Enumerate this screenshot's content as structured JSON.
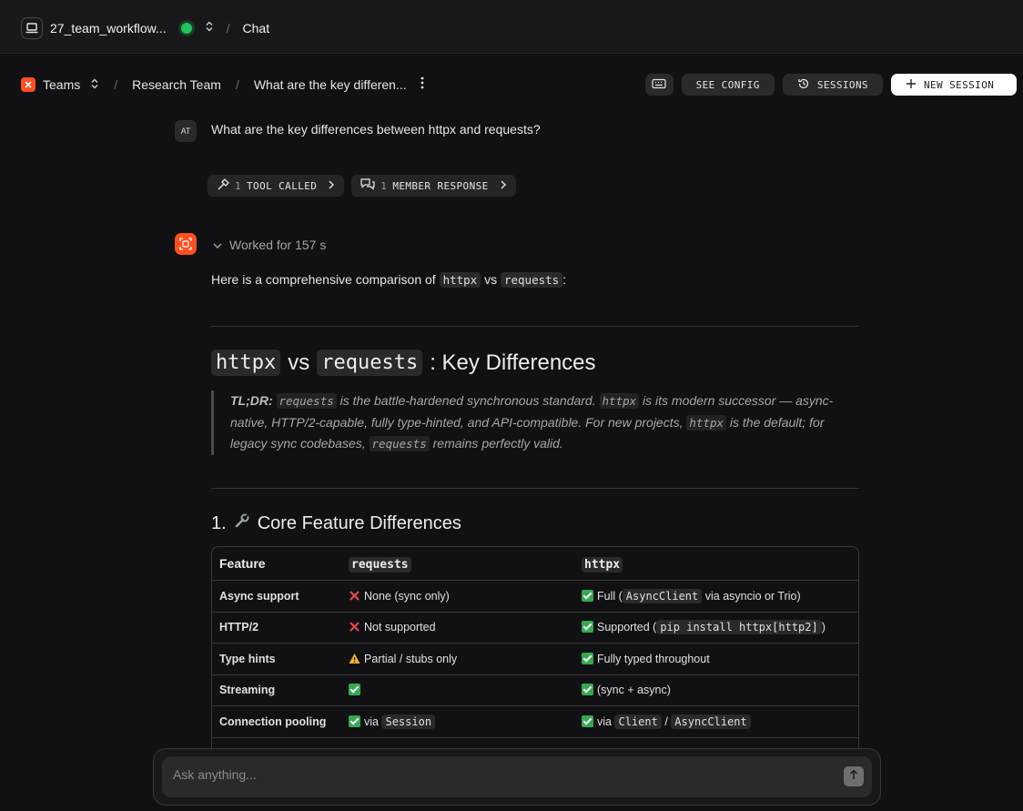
{
  "topbar": {
    "project_name": "27_team_workflow...",
    "status_color": "#22c55e",
    "separator": "/",
    "crumb": "Chat"
  },
  "nav": {
    "teams_label": "Teams",
    "team_name": "Research Team",
    "session_title": "What are the key differen...",
    "see_config": "SEE CONFIG",
    "sessions": "SESSIONS",
    "new_session": "NEW SESSION"
  },
  "message": {
    "avatar": "AT",
    "question": "What are the key differences between httpx and requests?"
  },
  "pills": {
    "tools_count": "1",
    "tools_label": "TOOL CALLED",
    "members_count": "1",
    "members_label": "MEMBER RESPONSE"
  },
  "response": {
    "worked": "Worked for 157 s",
    "intro_pre": "Here is a comprehensive comparison of",
    "intro_code1": "httpx",
    "intro_mid": "vs",
    "intro_code2": "requests",
    "intro_post": ":",
    "h2_code1": "httpx",
    "h2_mid": "vs",
    "h2_code2": "requests",
    "h2_post": ": Key Differences",
    "tldr_label": "TL;DR:",
    "tldr_1": "requests",
    "tldr_2": " is the battle-hardened synchronous standard. ",
    "tldr_3": "httpx",
    "tldr_4": " is its modern successor — async-native, HTTP/2-capable, fully type-hinted, and API-compatible. For new projects, ",
    "tldr_5": "httpx",
    "tldr_6": " is the default; for legacy sync codebases, ",
    "tldr_7": "requests",
    "tldr_8": " remains perfectly valid.",
    "h3_num": "1.",
    "h3_text": "Core Feature Differences"
  },
  "table": {
    "headers": [
      "Feature",
      "requests",
      "httpx"
    ],
    "rows": [
      {
        "feature": "Async support",
        "req": "None (sync only)",
        "httpx_pre": "Full (",
        "httpx_code": "AsyncClient",
        "httpx_post": " via asyncio or Trio)"
      },
      {
        "feature": "HTTP/2",
        "req": "Not supported",
        "httpx_pre": "Supported (",
        "httpx_code": "pip install httpx[http2]",
        "httpx_post": ")"
      },
      {
        "feature": "Type hints",
        "req": "Partial / stubs only",
        "httpx_text": "Fully typed throughout"
      },
      {
        "feature": "Streaming",
        "httpx_text": "(sync + async)"
      },
      {
        "feature": "Connection pooling",
        "req_pre": "via",
        "req_code": "Session",
        "httpx_pre": "via",
        "httpx_code1": "Client",
        "httpx_sep": "/",
        "httpx_code2": "AsyncClient"
      }
    ]
  },
  "composer": {
    "placeholder": "Ask anything..."
  }
}
